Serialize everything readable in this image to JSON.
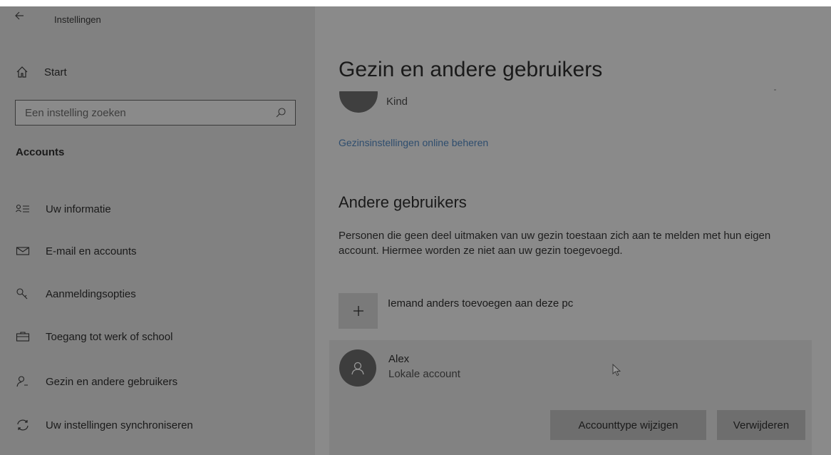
{
  "window": {
    "title": "Instellingen"
  },
  "sidebar": {
    "start_label": "Start",
    "search_placeholder": "Een instelling zoeken",
    "section_heading": "Accounts",
    "items": [
      {
        "label": "Uw informatie",
        "icon": "person-info-icon"
      },
      {
        "label": "E-mail en accounts",
        "icon": "mail-icon"
      },
      {
        "label": "Aanmeldingsopties",
        "icon": "key-icon"
      },
      {
        "label": "Toegang tot werk of school",
        "icon": "briefcase-icon"
      },
      {
        "label": "Gezin en andere gebruikers",
        "icon": "person-add-icon"
      },
      {
        "label": "Uw instellingen synchroniseren",
        "icon": "sync-icon"
      }
    ]
  },
  "main": {
    "title": "Gezin en andere gebruikers",
    "family_member_label": "Kind",
    "family_link": "Gezinsinstellingen online beheren",
    "others_heading": "Andere gebruikers",
    "others_description": "Personen die geen deel uitmaken van uw gezin toestaan zich aan te melden met hun eigen account. Hiermee worden ze niet aan uw gezin toegevoegd.",
    "add_label": "Iemand anders toevoegen aan deze pc",
    "user": {
      "name": "Alex",
      "type": "Lokale account",
      "change_type_button": "Accounttype wijzigen",
      "remove_button": "Verwijderen"
    }
  },
  "colors": {
    "overlay_gray": "#8a8a8a",
    "sidebar_gray": "#818181",
    "link": "#2e4d6e",
    "button": "#6e6e6e"
  }
}
